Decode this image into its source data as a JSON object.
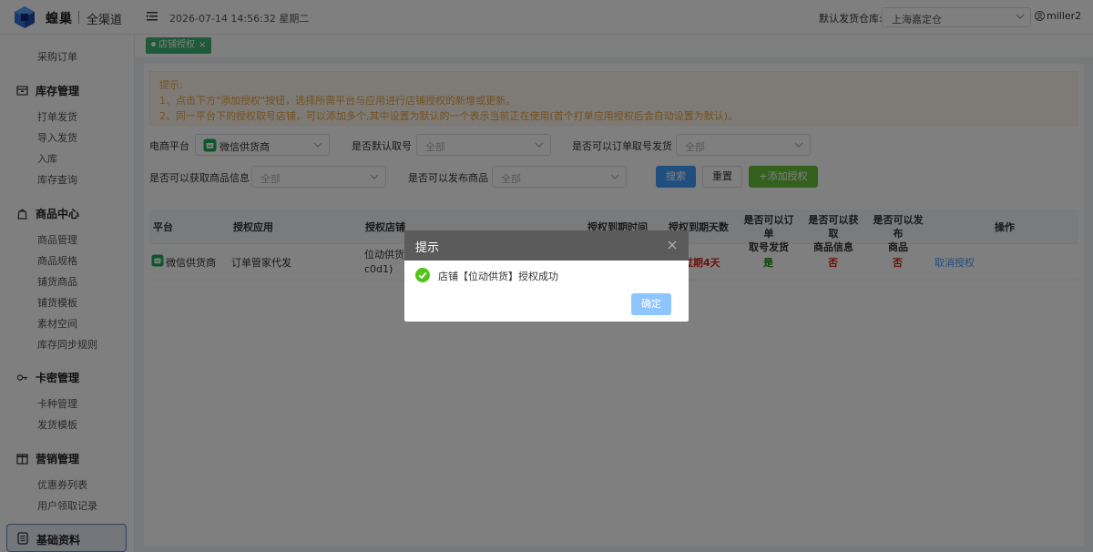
{
  "header": {
    "brand": "蝗巢",
    "brand_sub": "全渠道",
    "datetime": "2026-07-14 14:56:32 星期二",
    "warehouse_label": "默认发货仓库:",
    "warehouse_value": "上海嘉定仓",
    "user": "miller2"
  },
  "sidebar": {
    "top_item": "采购订单",
    "groups": [
      {
        "label": "库存管理",
        "icon": "box-icon",
        "items": [
          "打单发货",
          "导入发货",
          "入库",
          "库存查询"
        ]
      },
      {
        "label": "商品中心",
        "icon": "product-icon",
        "items": [
          "商品管理",
          "商品规格",
          "铺货商品",
          "铺货模板",
          "素材空间",
          "库存同步规则"
        ]
      },
      {
        "label": "卡密管理",
        "icon": "key-icon",
        "items": [
          "卡种管理",
          "发货模板"
        ]
      },
      {
        "label": "营销管理",
        "icon": "marketing-icon",
        "items": [
          "优惠券列表",
          "用户领取记录"
        ]
      }
    ],
    "active": {
      "label": "基础资料",
      "icon": "document-icon"
    }
  },
  "tabs": [
    {
      "label": "店铺授权",
      "close": "×"
    }
  ],
  "notice": {
    "title": "提示:",
    "line1": "1、点击下方\"添加授权\"按钮，选择所需平台与应用进行店铺授权的新增或更新。",
    "line2": "2、同一平台下的授权取号店铺，可以添加多个,其中设置为默认的一个表示当前正在使用(首个打单应用授权后会自动设置为默认)。"
  },
  "filters": {
    "platform_label": "电商平台",
    "platform_value": "微信供货商",
    "default_label": "是否默认取号",
    "default_ph": "全部",
    "order_label": "是否可以订单取号发货",
    "order_ph": "全部",
    "goods_label": "是否可以获取商品信息",
    "goods_ph": "全部",
    "publish_label": "是否可以发布商品",
    "publish_ph": "全部"
  },
  "buttons": {
    "search": "搜索",
    "reset": "重置",
    "add": "+添加授权"
  },
  "table": {
    "headers": {
      "platform": "平台",
      "app": "授权应用",
      "shop": "授权店铺",
      "expire_time": "授权到期时间",
      "expire_days": "授权到期天数",
      "order_l1": "是否可以订单",
      "order_l2": "取号发货",
      "goods_l1": "是否可以获取",
      "goods_l2": "商品信息",
      "publish_l1": "是否可以发布",
      "publish_l2": "商品",
      "actions": "操作"
    },
    "row": {
      "platform": "微信供货商",
      "app": "订单管家代发",
      "shop_l1": "位动供货",
      "shop_l2": "c0d1)",
      "expire_days": "过期4天",
      "order": "是",
      "goods": "否",
      "publish": "否",
      "action": "取消授权"
    }
  },
  "dialog": {
    "title": "提示",
    "message": "店铺【位动供货】授权成功",
    "confirm": "确定"
  },
  "colors": {
    "primary": "#409eff",
    "success": "#67c23a",
    "warning": "#e6a23c",
    "danger": "#d9241c",
    "positive": "#1a8a1a"
  }
}
